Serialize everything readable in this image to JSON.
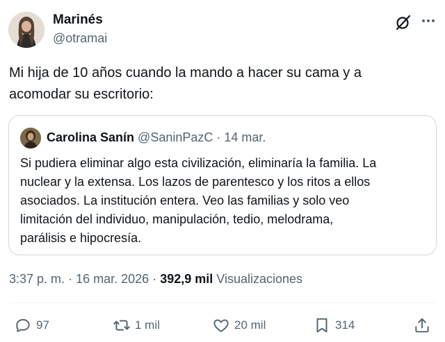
{
  "author": {
    "name": "Marinés",
    "handle": "@otramai"
  },
  "tweet": {
    "text_line1": "Mi hija de 10 años cuando la mando a hacer su cama y a",
    "text_line2": "acomodar su escritorio:"
  },
  "quoted": {
    "name": "Carolina Sanín",
    "handle": "@SaninPazC",
    "separator": "·",
    "date": "14 mar.",
    "lines": [
      "Si pudiera eliminar algo esta civilización, eliminaría la familia. La",
      "nuclear y la extensa. Los lazos de parentesco y los ritos a ellos",
      "asociados. La institución entera. Veo las familias y solo veo",
      "limitación del individuo, manipulación, tedio, melodrama,",
      "parálisis e hipocresía."
    ]
  },
  "meta": {
    "time": "3:37 p. m.",
    "separator": "·",
    "date": "16 mar. 2026",
    "views_count": "392,9 mil",
    "views_label": "Visualizaciones"
  },
  "actions": {
    "replies": "97",
    "reposts": "1 mil",
    "likes": "20 mil",
    "bookmarks": "314"
  },
  "icons": {
    "grok": "grok-icon",
    "more": "more-icon",
    "reply": "reply-icon",
    "repost": "repost-icon",
    "like": "heart-icon",
    "bookmark": "bookmark-icon",
    "share": "share-icon"
  },
  "colors": {
    "text": "#0f1419",
    "secondary": "#536471",
    "border": "#cfd9de"
  }
}
